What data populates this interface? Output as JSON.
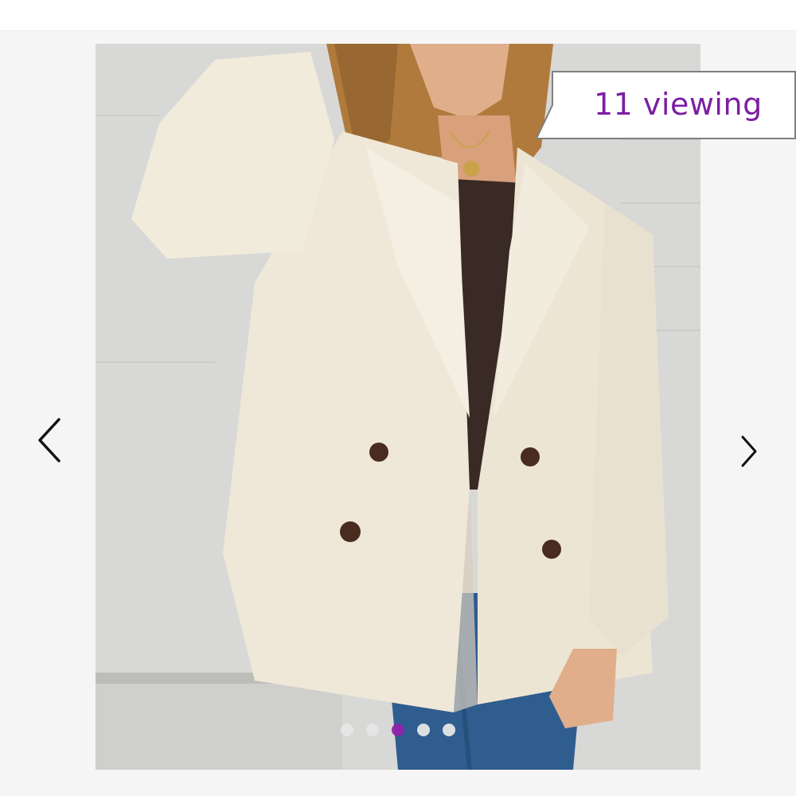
{
  "badge": {
    "viewing_text": "11 viewing",
    "text_color": "#7b1fa2",
    "border_color": "#7f7f7f"
  },
  "carousel": {
    "total_images": 5,
    "active_index": 2,
    "active_dot_color": "#8e24aa",
    "inactive_dot_color": "#e6e6e6",
    "prev_icon": "chevron-left-icon",
    "next_icon": "chevron-right-icon"
  },
  "image": {
    "subject": "product-photo"
  }
}
